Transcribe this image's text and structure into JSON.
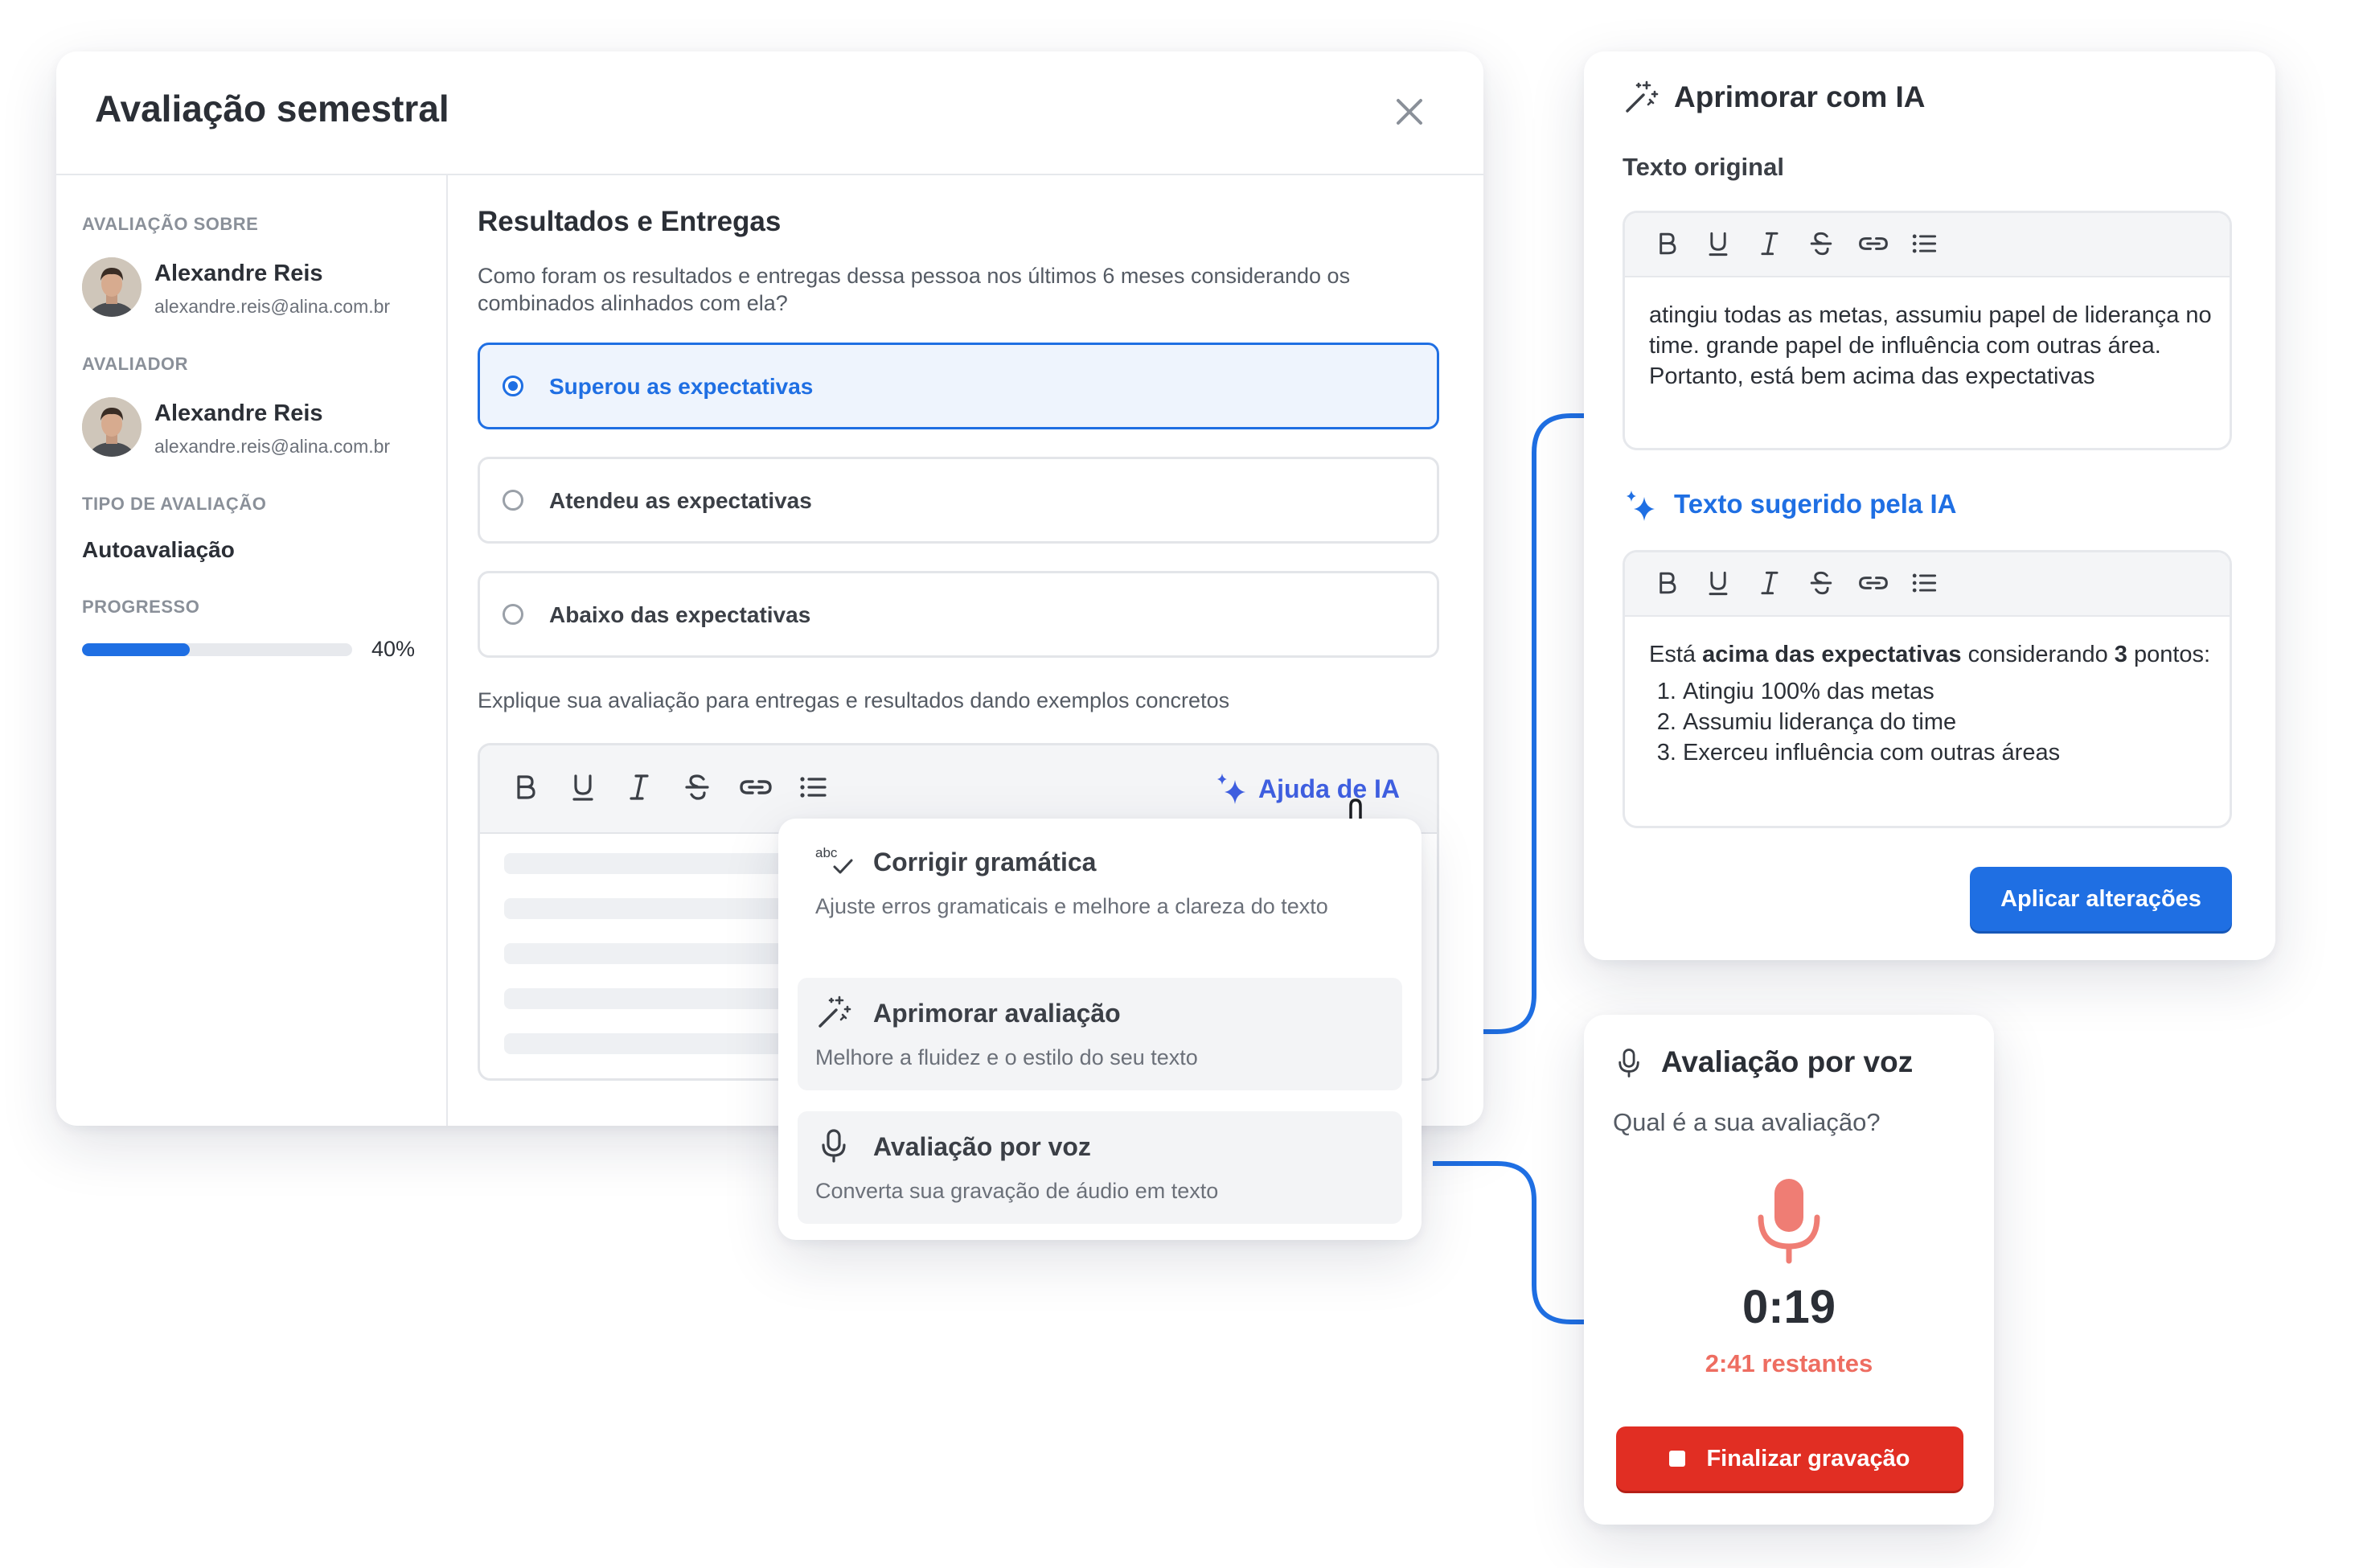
{
  "modal": {
    "title": "Avaliação semestral",
    "evaluated_label": "AVALIAÇÃO SOBRE",
    "evaluated_name": "Alexandre Reis",
    "evaluated_email": "alexandre.reis@alina.com.br",
    "evaluator_label": "AVALIADOR",
    "evaluator_name": "Alexandre Reis",
    "evaluator_email": "alexandre.reis@alina.com.br",
    "type_label": "TIPO DE AVALIAÇÃO",
    "type_value": "Autoavaliação",
    "progress_label": "PROGRESSO",
    "progress_value": 0.4,
    "progress_text": "40%",
    "question_title": "Resultados e Entregas",
    "question_desc": "Como foram os resultados e entregas dessa pessoa nos últimos 6 meses considerando os combinados alinhados com ela?",
    "options": [
      {
        "label": "Superou as expectativas",
        "selected": true
      },
      {
        "label": "Atendeu as expectativas",
        "selected": false
      },
      {
        "label": "Abaixo das expectativas",
        "selected": false
      }
    ],
    "explain_label": "Explique sua avaliação para entregas e resultados dando exemplos concretos",
    "ai_help_label": "Ajuda de IA"
  },
  "dropdown": {
    "items": [
      {
        "title": "Corrigir gramática",
        "subtitle": "Ajuste erros gramaticais e melhore a clareza do texto",
        "icon": "spellcheck-icon"
      },
      {
        "title": "Aprimorar avaliação",
        "subtitle": "Melhore a fluidez e o estilo do seu texto",
        "icon": "magic-wand-icon"
      },
      {
        "title": "Avaliação por voz",
        "subtitle": "Converta sua gravação de áudio em texto",
        "icon": "microphone-icon"
      }
    ]
  },
  "ai_card": {
    "title": "Aprimorar com IA",
    "original_label": "Texto original",
    "original_text": "atingiu todas as metas, assumiu papel de liderança no time. grande papel de influência com outras área. Portanto, está bem acima das expectativas",
    "suggested_label": "Texto sugerido pela IA",
    "suggested_intro_1": "Está ",
    "suggested_bold_1": "acima das expectativas",
    "suggested_intro_2": " considerando ",
    "suggested_bold_2": "3",
    "suggested_intro_3": " pontos:",
    "suggested_points": [
      "Atingiu 100% das metas",
      "Assumiu liderança do time",
      "Exerceu influência com outras áreas"
    ],
    "apply_label": "Aplicar alterações"
  },
  "voice_card": {
    "title": "Avaliação por voz",
    "question": "Qual é a sua avaliação?",
    "timer": "0:19",
    "remaining": "2:41 restantes",
    "stop_label": "Finalizar gravação"
  },
  "colors": {
    "accent_blue": "#1f6fe3",
    "ai_purple_blue": "#3f5fe0",
    "record_red": "#e12e23",
    "mic_pink": "#ef7d74"
  }
}
